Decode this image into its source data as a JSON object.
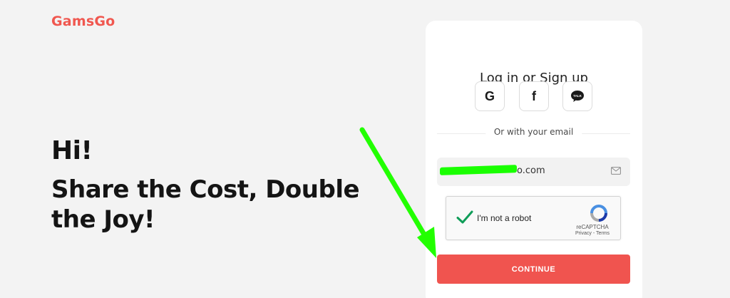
{
  "brand": {
    "logo_text": "GamsGo",
    "accent_color": "#f0574f"
  },
  "hero": {
    "greeting": "Hi!",
    "tagline": "Share the Cost, Double the Joy!"
  },
  "auth": {
    "title": "Log in or Sign up",
    "social": [
      {
        "name": "google",
        "icon": "google-icon",
        "glyph": "G"
      },
      {
        "name": "facebook",
        "icon": "facebook-icon",
        "glyph": "f"
      },
      {
        "name": "kakaotalk",
        "icon": "kakaotalk-icon",
        "glyph": "TALK"
      }
    ],
    "divider_text": "Or with your email",
    "email": {
      "value": "o.com",
      "icon": "mail-icon",
      "redacted": true
    },
    "recaptcha": {
      "label": "I'm not a robot",
      "checked": true,
      "brand": "reCAPTCHA",
      "links": "Privacy - Terms"
    },
    "continue_label": "CONTINUE",
    "button_color": "#f0544f"
  },
  "annotation": {
    "type": "arrow",
    "color": "#22ff00",
    "points_to": "continue-button"
  }
}
